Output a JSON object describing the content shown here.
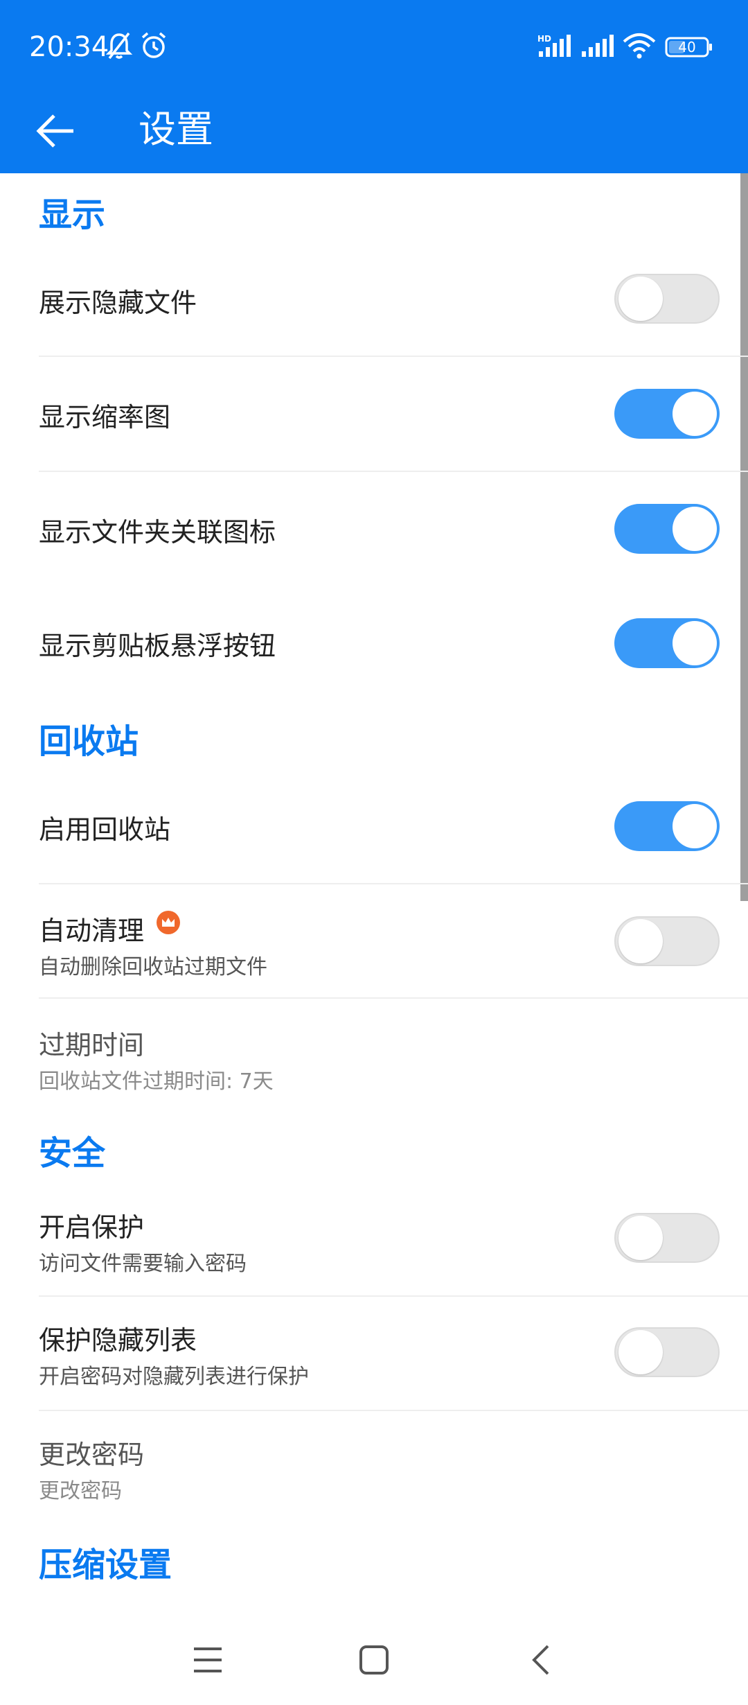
{
  "status_bar": {
    "time": "20:34",
    "icons": [
      "bell-off-icon",
      "alarm-icon",
      "hd-signal-icon",
      "signal-icon",
      "wifi-icon",
      "battery-icon"
    ],
    "battery": "40"
  },
  "header": {
    "back_icon": "arrow-left-icon",
    "title": "设置"
  },
  "sections": {
    "display": {
      "header": "显示",
      "items": [
        {
          "title": "展示隐藏文件",
          "toggle": false
        },
        {
          "title": "显示缩率图",
          "toggle": true
        },
        {
          "title": "显示文件夹关联图标",
          "toggle": true
        },
        {
          "title": "显示剪贴板悬浮按钮",
          "toggle": true
        }
      ]
    },
    "recycle": {
      "header": "回收站",
      "items": [
        {
          "title": "启用回收站",
          "toggle": true
        },
        {
          "title": "自动清理",
          "subtitle": "自动删除回收站过期文件",
          "toggle": false,
          "badge_icon": "crown-icon"
        },
        {
          "title": "过期时间",
          "subtitle": "回收站文件过期时间: 7天"
        }
      ]
    },
    "security": {
      "header": "安全",
      "items": [
        {
          "title": "开启保护",
          "subtitle": "访问文件需要输入密码",
          "toggle": false
        },
        {
          "title": "保护隐藏列表",
          "subtitle": "开启密码对隐藏列表进行保护",
          "toggle": false
        },
        {
          "title": "更改密码",
          "subtitle": "更改密码"
        }
      ]
    },
    "compression": {
      "header": "压缩设置"
    }
  },
  "nav_bar": {
    "icons": [
      "menu-icon",
      "home-square-icon",
      "back-chevron-icon"
    ]
  },
  "colors": {
    "accent": "#0a7af0",
    "toggle_on": "#3a9af8",
    "toggle_off": "#e6e6e6"
  }
}
